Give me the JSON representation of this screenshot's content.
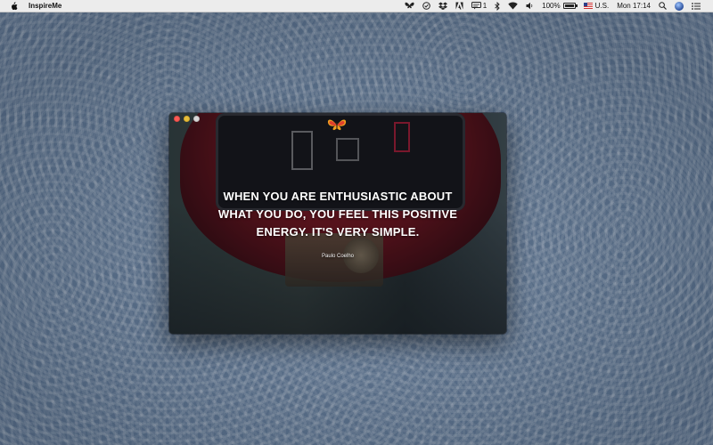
{
  "menubar": {
    "app_name": "InspireMe",
    "notification_count": "1",
    "battery_percent": "100%",
    "battery_level": 1.0,
    "input_source": "U.S.",
    "clock": "Mon 17:14",
    "icons": [
      "butterfly-icon",
      "checkmark-circle-icon",
      "dropbox-icon",
      "adobe-icon",
      "notification-icon",
      "bluetooth-icon",
      "wifi-icon",
      "volume-icon",
      "battery-icon",
      "flag-icon",
      "search-icon",
      "siri-icon",
      "list-icon"
    ]
  },
  "window": {
    "quote": "When you are enthusiastic about what you do, you feel this positive energy. It's very simple.",
    "author": "Paulo Coelho"
  },
  "colors": {
    "close": "#fc5b57",
    "minimize": "#e5bf3c",
    "zoom_disabled": "#d8d8d8",
    "desktop": "#5b7391"
  }
}
